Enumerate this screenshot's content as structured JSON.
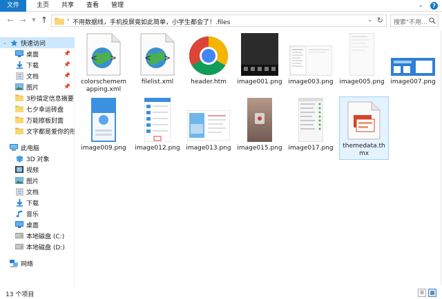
{
  "ribbon": {
    "tabs": [
      {
        "label": "文件"
      },
      {
        "label": "主页"
      },
      {
        "label": "共享"
      },
      {
        "label": "查看"
      },
      {
        "label": "管理"
      }
    ]
  },
  "address": {
    "path_text": "不用数据线，手机投屏竟如此简单，小学生都会了！.files",
    "search_placeholder": "搜索\"不用..."
  },
  "nav": {
    "quick_access": "快速访问",
    "quick_items": [
      {
        "label": "桌面",
        "icon": "desktop-icon"
      },
      {
        "label": "下载",
        "icon": "download-icon"
      },
      {
        "label": "文档",
        "icon": "documents-icon"
      },
      {
        "label": "图片",
        "icon": "pictures-icon"
      },
      {
        "label": "3秒搞定信息摘要",
        "icon": "folder-icon"
      },
      {
        "label": "七夕幸运砖盘",
        "icon": "folder-icon"
      },
      {
        "label": "万能擦板封面",
        "icon": "folder-icon"
      },
      {
        "label": "文字都是爱你的形状",
        "icon": "folder-icon"
      }
    ],
    "this_pc": "此电脑",
    "pc_items": [
      {
        "label": "3D 对象",
        "icon": "3d-objects-icon"
      },
      {
        "label": "视频",
        "icon": "videos-icon"
      },
      {
        "label": "图片",
        "icon": "pictures-icon"
      },
      {
        "label": "文档",
        "icon": "documents-icon"
      },
      {
        "label": "下载",
        "icon": "download-icon"
      },
      {
        "label": "音乐",
        "icon": "music-icon"
      },
      {
        "label": "桌面",
        "icon": "desktop-icon"
      },
      {
        "label": "本地磁盘 (C:)",
        "icon": "drive-icon"
      },
      {
        "label": "本地磁盘 (D:)",
        "icon": "drive-icon"
      }
    ],
    "network": "网络"
  },
  "files": [
    {
      "name": "colorschememapping.xml",
      "type": "xml"
    },
    {
      "name": "filelist.xml",
      "type": "xml"
    },
    {
      "name": "header.htm",
      "type": "chrome"
    },
    {
      "name": "image001.png",
      "type": "png"
    },
    {
      "name": "image003.png",
      "type": "png"
    },
    {
      "name": "image005.png",
      "type": "png"
    },
    {
      "name": "image007.png",
      "type": "png"
    },
    {
      "name": "image009.png",
      "type": "png"
    },
    {
      "name": "image012.png",
      "type": "png"
    },
    {
      "name": "image013.png",
      "type": "png"
    },
    {
      "name": "image015.png",
      "type": "png"
    },
    {
      "name": "image017.png",
      "type": "png"
    },
    {
      "name": "themedata.thmx",
      "type": "thmx"
    }
  ],
  "status": {
    "count_text": "13 个项目"
  },
  "colors": {
    "accent": "#1979ca",
    "selection": "#cce8ff",
    "folder": "#f6c343"
  }
}
